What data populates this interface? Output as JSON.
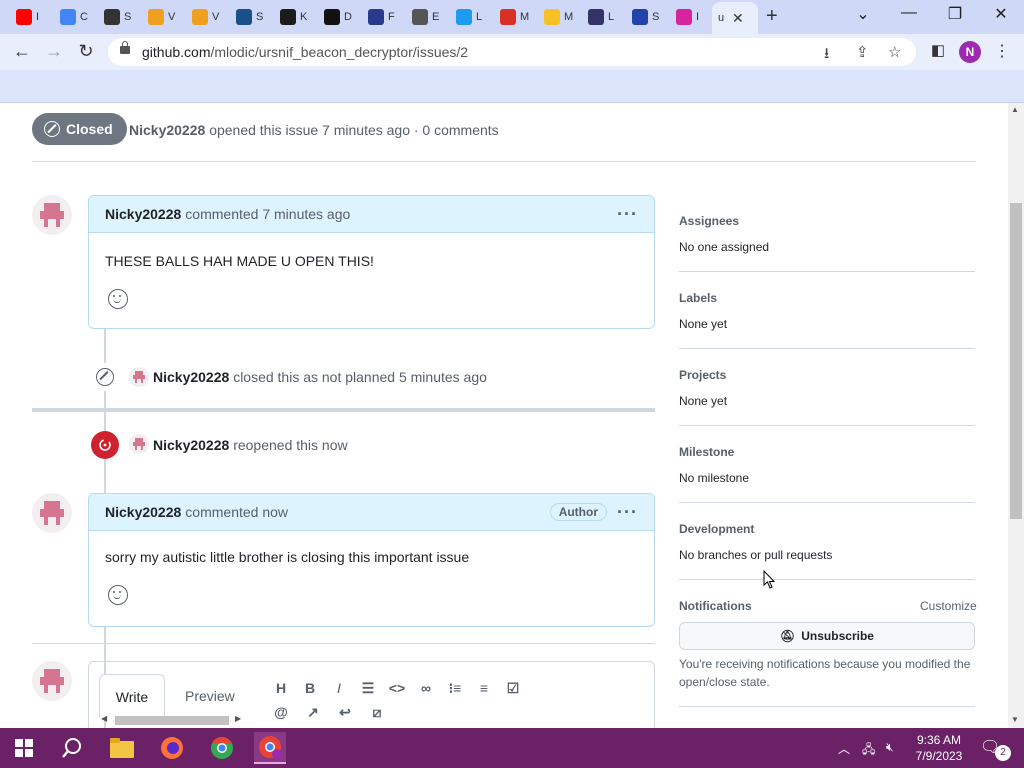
{
  "browser": {
    "tabs": [
      {
        "title": "I",
        "color": "#ff0000",
        "icon": "youtube-icon"
      },
      {
        "title": "C",
        "color": "#4285f4",
        "icon": "google-icon"
      },
      {
        "title": "S",
        "color": "#333333",
        "icon": "settings-icon"
      },
      {
        "title": "V",
        "color": "#f0a020",
        "icon": "slides-icon"
      },
      {
        "title": "V",
        "color": "#f0a020",
        "icon": "slides-icon"
      },
      {
        "title": "S",
        "color": "#1a4f8a",
        "icon": "site-icon"
      },
      {
        "title": "K",
        "color": "#1b1b1b",
        "icon": "kim-icon"
      },
      {
        "title": "D",
        "color": "#111111",
        "icon": "qr-icon"
      },
      {
        "title": "F",
        "color": "#2a3a8a",
        "icon": "game-icon"
      },
      {
        "title": "E",
        "color": "#555555",
        "icon": "site-icon"
      },
      {
        "title": "L",
        "color": "#1d9bf0",
        "icon": "twitter-icon"
      },
      {
        "title": "M",
        "color": "#d93025",
        "icon": "gmail-icon"
      },
      {
        "title": "M",
        "color": "#f6c026",
        "icon": "bulb-icon"
      },
      {
        "title": "L",
        "color": "#333366",
        "icon": "site-icon"
      },
      {
        "title": "S",
        "color": "#2244aa",
        "icon": "sonic-icon"
      },
      {
        "title": "I",
        "color": "#d6249f",
        "icon": "instagram-icon"
      },
      {
        "title": "u",
        "color": "#ffffff",
        "icon": "github-icon",
        "active": true
      }
    ],
    "url_domain": "github.com",
    "url_path": "/mlodic/ursnif_beacon_decryptor/issues/2",
    "profile_initial": "N"
  },
  "issue": {
    "state": "Closed",
    "author": "Nicky20228",
    "meta": "opened this issue 7 minutes ago · 0 comments"
  },
  "comments": [
    {
      "author": "Nicky20228",
      "action": "commented 7 minutes ago",
      "body": "THESE BALLS HAH MADE U OPEN THIS!",
      "label": ""
    },
    {
      "author": "Nicky20228",
      "action": "commented now",
      "body": "sorry my autistic little brother is closing this important issue",
      "label": "Author"
    }
  ],
  "events": [
    {
      "actor": "Nicky20228",
      "text": "closed this as not planned 5 minutes ago"
    },
    {
      "actor": "Nicky20228",
      "text": "reopened this now"
    }
  ],
  "editor": {
    "write": "Write",
    "preview": "Preview"
  },
  "sidebar": {
    "assignees": {
      "title": "Assignees",
      "value": "No one assigned"
    },
    "labels": {
      "title": "Labels",
      "value": "None yet"
    },
    "projects": {
      "title": "Projects",
      "value": "None yet"
    },
    "milestone": {
      "title": "Milestone",
      "value": "No milestone"
    },
    "development": {
      "title": "Development",
      "value": "No branches or pull requests"
    },
    "notifications": {
      "title": "Notifications",
      "customize": "Customize",
      "button": "Unsubscribe",
      "notice": "You're receiving notifications because you modified the open/close state."
    }
  },
  "taskbar": {
    "time": "9:36 AM",
    "date": "7/9/2023",
    "notif_count": "2"
  },
  "colors": {
    "closed": "#6e7781",
    "reopened": "#cf222e",
    "comment_head": "#ddf4ff",
    "taskbar": "#6b2166"
  }
}
